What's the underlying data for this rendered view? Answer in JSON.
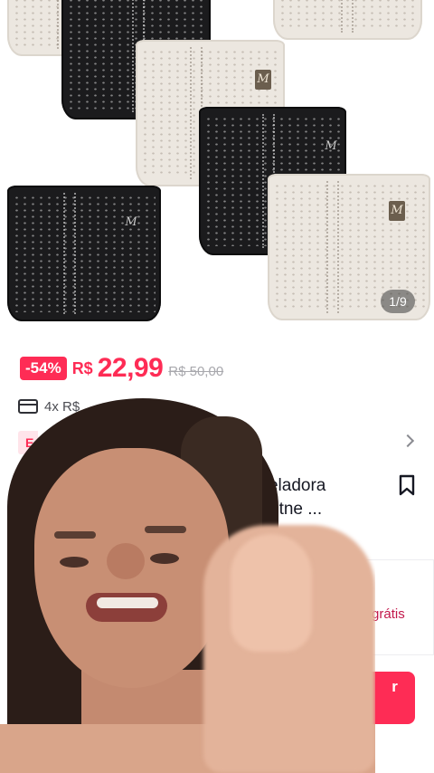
{
  "gallery": {
    "image_counter": "1/9",
    "logo_mark": "M"
  },
  "price": {
    "discount": "-54%",
    "currency": "R$",
    "value": "22,99",
    "original": "R$ 50,00"
  },
  "installments": {
    "text": "4x R$"
  },
  "promo": {
    "tag_fragment": "E"
  },
  "product": {
    "title_line1": "Modeladora",
    "title_line2": "her Fitne ..."
  },
  "sample": {
    "label": "Amostra grátis"
  },
  "buy": {
    "label": "r"
  },
  "colors": {
    "accent": "#fe2c55",
    "sample_text": "#c2184b",
    "text_primary": "#161823",
    "text_muted": "#a8a8ad"
  },
  "icons": [
    "card-icon",
    "chevron-right-icon",
    "bookmark-icon"
  ]
}
